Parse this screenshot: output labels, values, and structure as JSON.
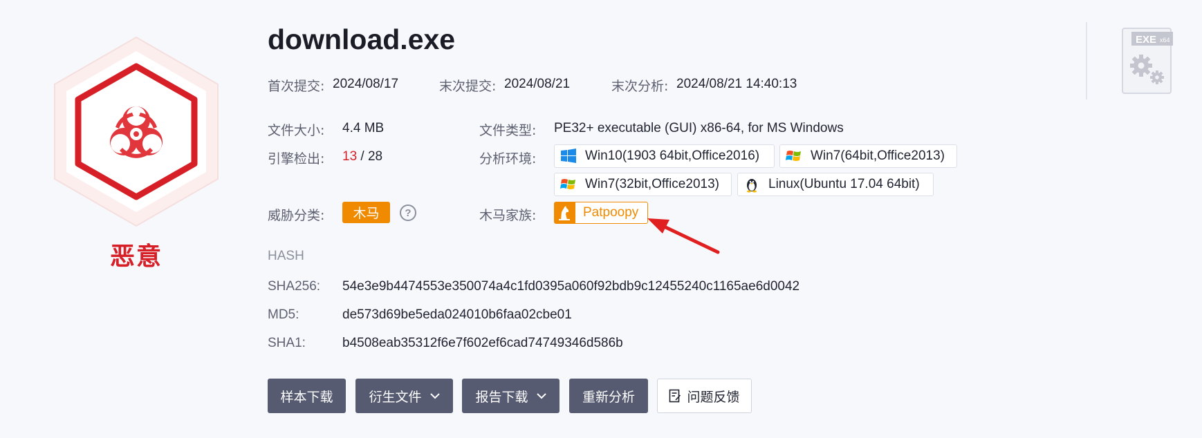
{
  "verdict": {
    "label": "恶意",
    "color": "#d61f26"
  },
  "file": {
    "name": "download.exe"
  },
  "dates": {
    "first_submit_label": "首次提交:",
    "first_submit": "2024/08/17",
    "last_submit_label": "末次提交:",
    "last_submit": "2024/08/21",
    "last_analysis_label": "末次分析:",
    "last_analysis": "2024/08/21 14:40:13"
  },
  "details": {
    "size_label": "文件大小:",
    "size": "4.4 MB",
    "type_label": "文件类型:",
    "type": "PE32+ executable (GUI) x86-64, for MS Windows",
    "engines_label": "引擎检出:",
    "engines_detected": "13",
    "engines_separator": "/",
    "engines_total": "28",
    "env_label": "分析环境:",
    "environments": [
      {
        "label": "Win10(1903 64bit,Office2016)",
        "icon": "windows10-icon"
      },
      {
        "label": "Win7(64bit,Office2013)",
        "icon": "windows7-icon"
      },
      {
        "label": "Win7(32bit,Office2013)",
        "icon": "windows7-icon"
      },
      {
        "label": "Linux(Ubuntu 17.04 64bit)",
        "icon": "linux-tux-icon"
      }
    ],
    "threat_label": "威胁分类:",
    "threat": "木马",
    "help_icon": "?",
    "family_label": "木马家族:",
    "family": "Patpoopy"
  },
  "hash": {
    "title": "HASH",
    "sha256_label": "SHA256:",
    "sha256": "54e3e9b4474553e350074a4c1fd0395a060f92bdb9c12455240c1165ae6d0042",
    "md5_label": "MD5:",
    "md5": "de573d69be5eda024010b6faa02cbe01",
    "sha1_label": "SHA1:",
    "sha1": "b4508eab35312f6e7f602ef6cad74749346d586b"
  },
  "actions": {
    "download_sample": "样本下载",
    "derived_files": "衍生文件",
    "download_report": "报告下载",
    "reanalyze": "重新分析",
    "feedback": "问题反馈"
  },
  "filetype_icon": {
    "badge": "EXE",
    "arch": "x64"
  },
  "colors": {
    "accent": "#f08a00",
    "danger": "#d61f26",
    "button": "#565b72"
  }
}
